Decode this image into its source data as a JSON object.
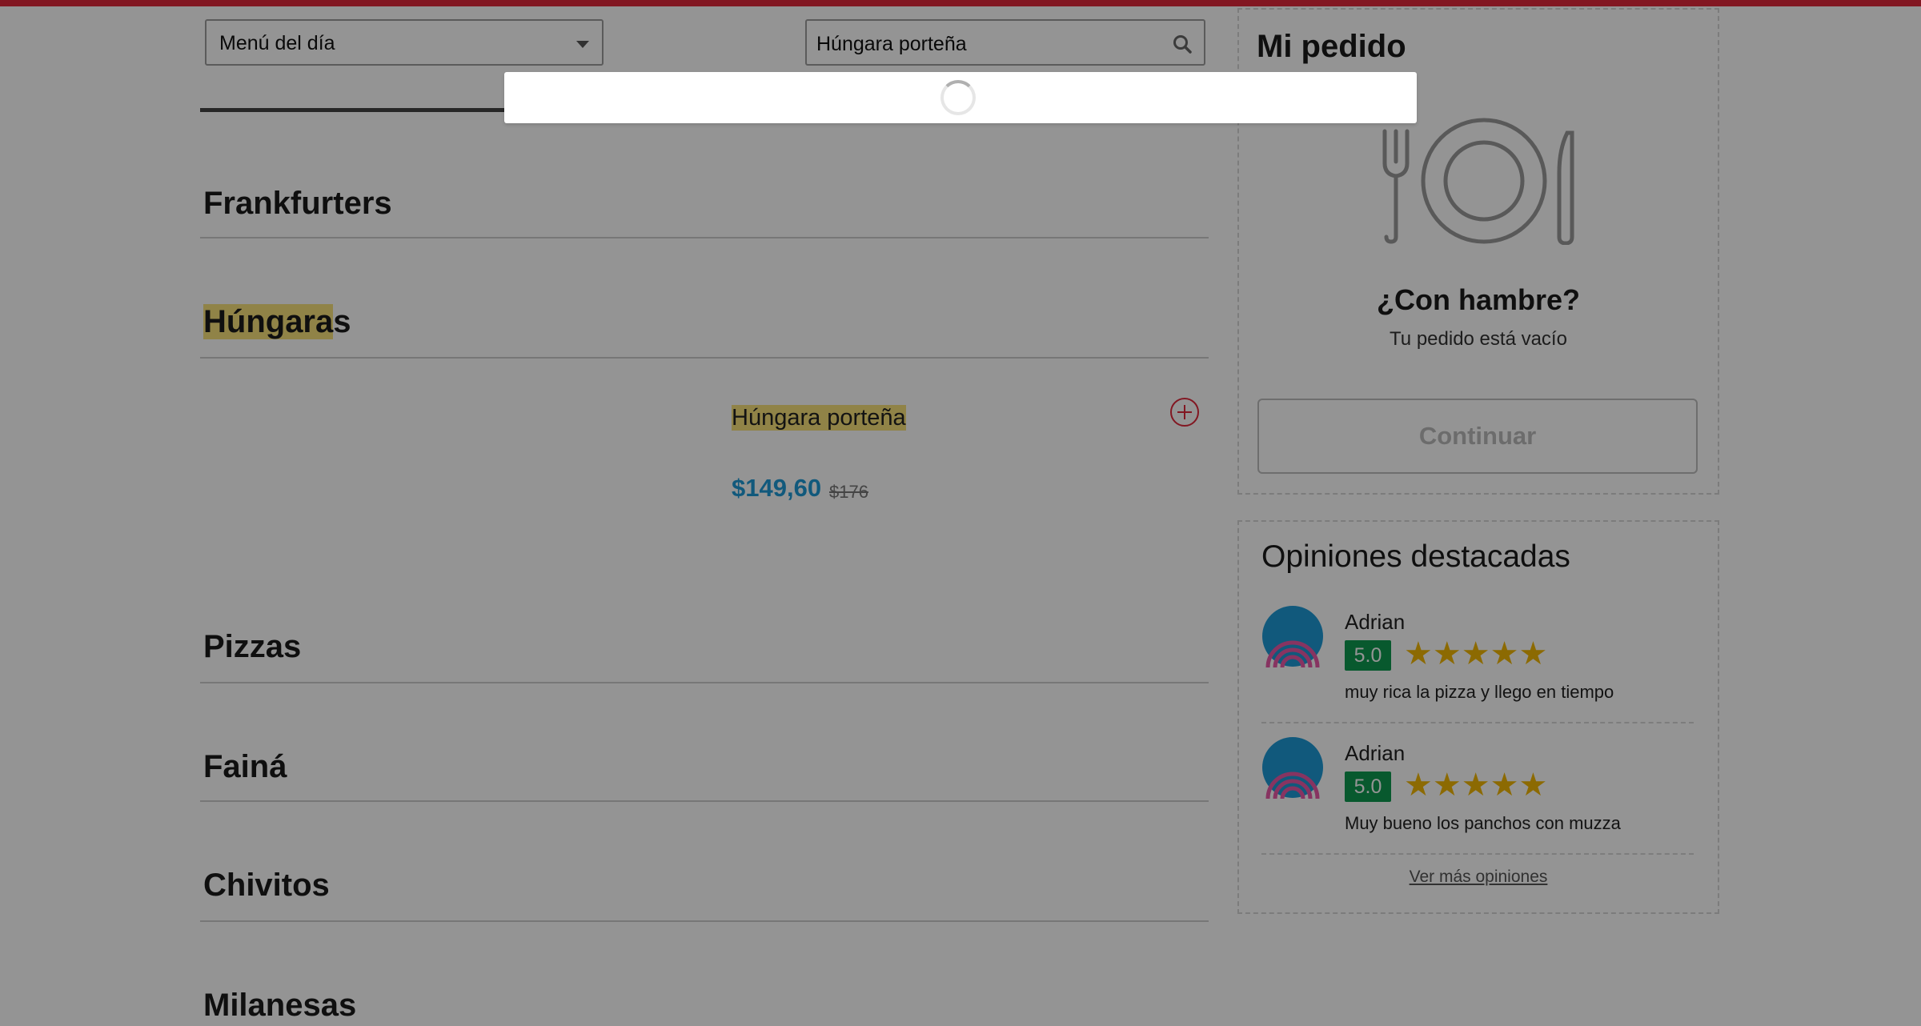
{
  "header": {
    "menu_select": "Menú del día",
    "search_value": "Húngara porteña"
  },
  "categories": [
    "Frankfurters",
    "Húngaras",
    "Pizzas",
    "Fainá",
    "Chivitos",
    "Milanesas"
  ],
  "highlight": {
    "hungaras_match": "Húngara",
    "hungaras_rest": "s"
  },
  "product": {
    "name": "Húngara porteña",
    "price": "$149,60",
    "old_price": "$176"
  },
  "order": {
    "title": "Mi pedido",
    "hungry": "¿Con hambre?",
    "empty": "Tu pedido está vacío",
    "continue_label": "Continuar"
  },
  "reviews": {
    "title": "Opiniones destacadas",
    "items": [
      {
        "name": "Adrian",
        "score": "5.0",
        "stars": 5,
        "text": "muy rica la pizza y llego en tiempo"
      },
      {
        "name": "Adrian",
        "score": "5.0",
        "stars": 5,
        "text": "Muy bueno los panchos con muzza"
      }
    ],
    "more_label": "Ver más opiniones"
  },
  "colors": {
    "brand_red": "#e0293b",
    "price_blue": "#1e9ad6",
    "score_green": "#0e9a50",
    "star_yellow": "#f2b705",
    "highlight_yellow": "#f8e27a"
  },
  "icons": [
    "search-icon",
    "add-icon",
    "plate-cutlery-icon",
    "avatar-icon",
    "star-icon",
    "spinner-icon"
  ]
}
